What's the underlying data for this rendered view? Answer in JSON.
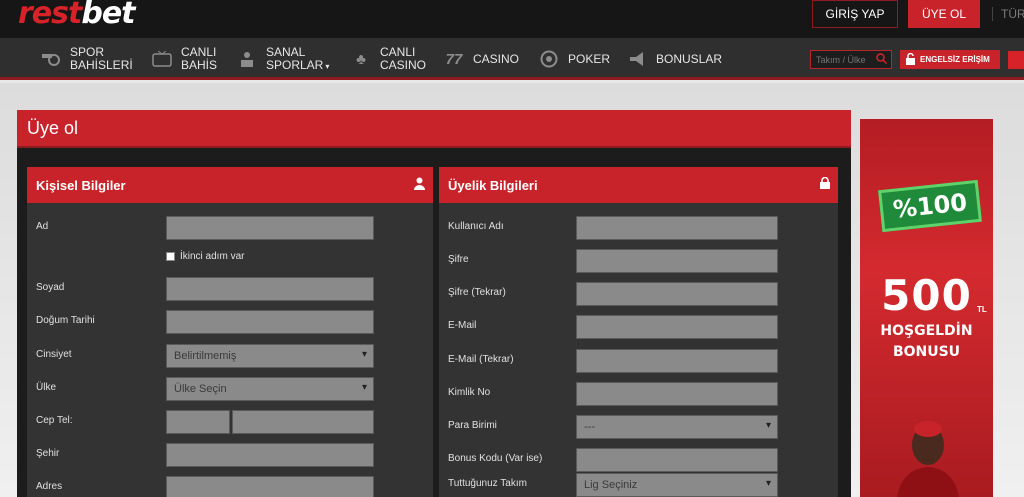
{
  "header": {
    "logo_part1": "rest",
    "logo_part2": "bet",
    "login_label": "GİRİŞ YAP",
    "register_label": "ÜYE OL",
    "language": "TÜR"
  },
  "nav": {
    "items": [
      {
        "line1": "SPOR",
        "line2": "BAHİSLERİ",
        "icon": "whistle-icon"
      },
      {
        "line1": "CANLI",
        "line2": "BAHİS",
        "icon": "live-tv-icon"
      },
      {
        "line1": "SANAL",
        "line2": "SPORLAR",
        "icon": "virtual-sports-icon",
        "caret": "▾"
      },
      {
        "line1": "CANLI",
        "line2": "CASINO",
        "icon": "cards-icon"
      },
      {
        "line1": "CASINO",
        "line2": "",
        "icon": "seven-icon"
      },
      {
        "line1": "POKER",
        "line2": "",
        "icon": "poker-chip-icon"
      },
      {
        "line1": "BONUSLAR",
        "line2": "",
        "icon": "megaphone-icon"
      }
    ],
    "search_placeholder": "Takım / Ülke",
    "access_label": "ENGELSİZ ERİŞİM"
  },
  "page": {
    "title": "Üye ol"
  },
  "personal": {
    "title": "Kişisel Bilgiler",
    "icon": "user-icon",
    "first_name_label": "Ad",
    "second_name_check": "İkinci adım var",
    "last_name_label": "Soyad",
    "birth_label": "Doğum Tarihi",
    "gender_label": "Cinsiyet",
    "gender_value": "Belirtilmemiş",
    "country_label": "Ülke",
    "country_value": "Ülke Seçin",
    "phone_label": "Cep Tel:",
    "city_label": "Şehir",
    "address_label": "Adres"
  },
  "membership": {
    "title": "Üyelik Bilgileri",
    "icon": "lock-icon",
    "username_label": "Kullanıcı Adı",
    "password_label": "Şifre",
    "password_repeat_label": "Şifre (Tekrar)",
    "email_label": "E-Mail",
    "email_repeat_label": "E-Mail (Tekrar)",
    "id_label": "Kimlik No",
    "currency_label": "Para Birimi",
    "currency_value": "---",
    "bonus_label": "Bonus Kodu (Var ise)",
    "team_label": "Tuttuğunuz Takım",
    "team_value": "Lig Seçiniz"
  },
  "banner": {
    "badge": "%100",
    "amount": "500",
    "currency": "TL",
    "line1": "HOŞGELDİN",
    "line2": "BONUSU"
  },
  "colors": {
    "brand_red": "#c8232a",
    "dark": "#1c1c1c",
    "nav": "#2f2f2f"
  }
}
